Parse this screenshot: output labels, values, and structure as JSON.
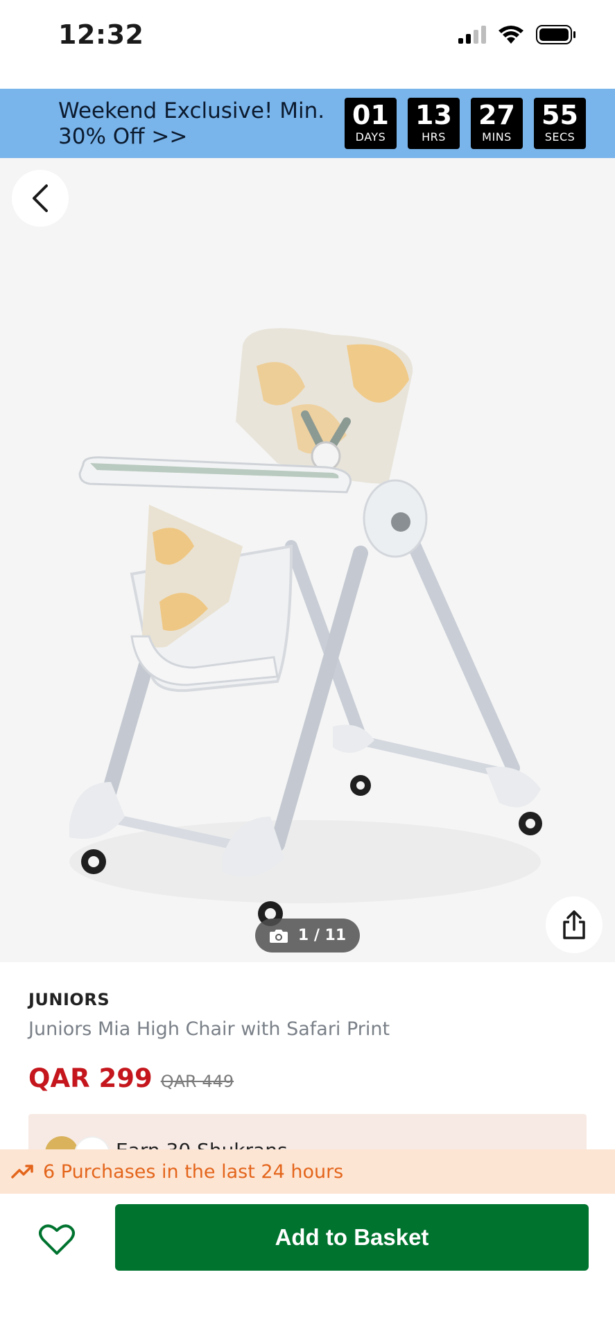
{
  "status_bar": {
    "time": "12:32"
  },
  "promo": {
    "text": "Weekend Exclusive! Min. 30% Off >>",
    "countdown": [
      {
        "value": "01",
        "label": "DAYS"
      },
      {
        "value": "13",
        "label": "HRS"
      },
      {
        "value": "27",
        "label": "MINS"
      },
      {
        "value": "55",
        "label": "SECS"
      }
    ],
    "bg_color": "#79b4ea"
  },
  "gallery": {
    "counter": "1 / 11"
  },
  "product": {
    "brand": "JUNIORS",
    "title": "Juniors Mia High Chair with Safari Print",
    "price": "QAR 299",
    "old_price": "QAR 449",
    "offer_text": "Earn 30 Shukrans..."
  },
  "purchases_banner": {
    "text": "6 Purchases in the last 24 hours"
  },
  "actions": {
    "add_to_basket": "Add to Basket"
  },
  "colors": {
    "price": "#c4161c",
    "button": "#00732f",
    "banner_text": "#e3651b"
  }
}
